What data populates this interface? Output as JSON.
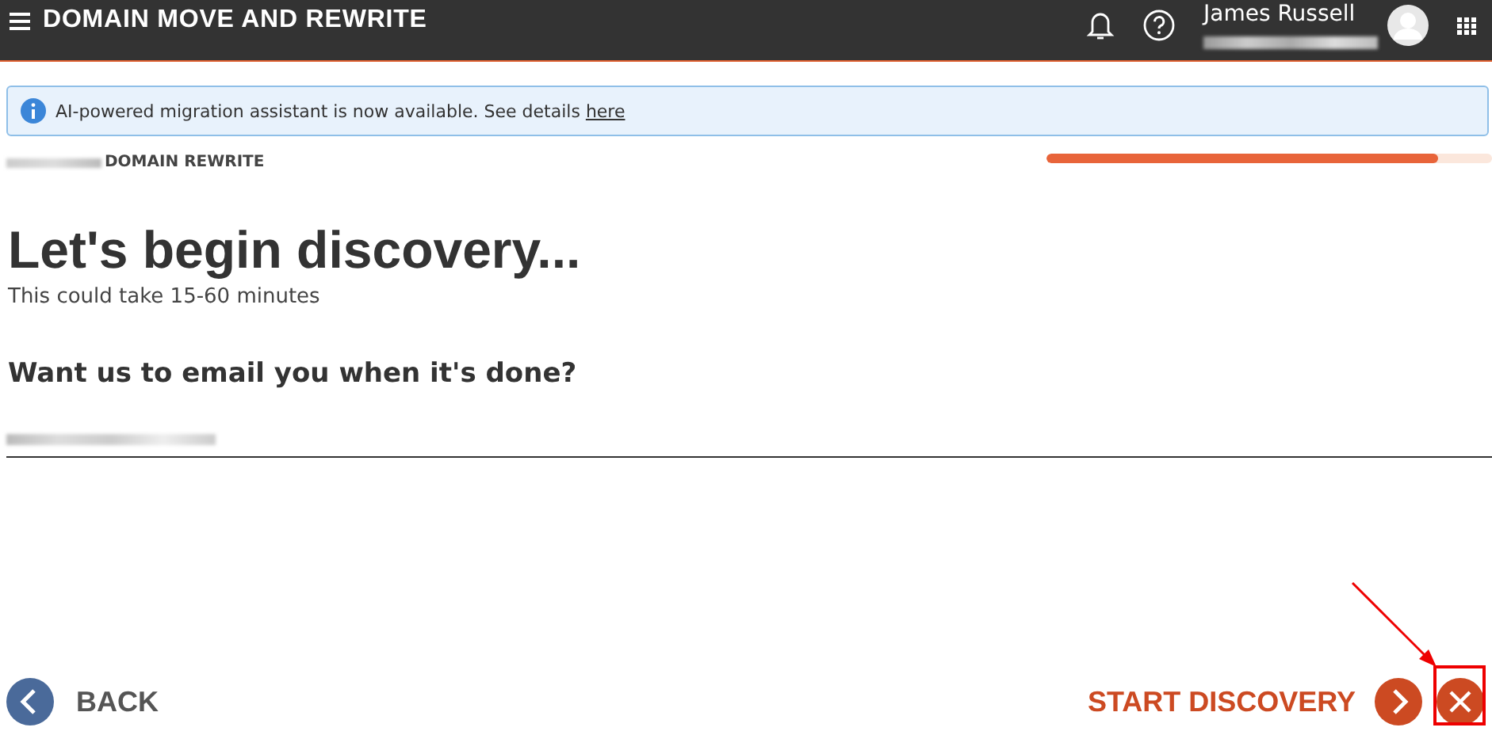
{
  "header": {
    "title": "DOMAIN MOVE AND REWRITE",
    "user_name": "James Russell"
  },
  "banner": {
    "text": "AI-powered migration assistant is now available. See details ",
    "link": "here"
  },
  "breadcrumb": {
    "current": "DOMAIN REWRITE"
  },
  "progress": {
    "level": 0.88
  },
  "heading": "Let's begin discovery...",
  "subtitle": "This could take 15-60 minutes",
  "question": "Want us to email you when it's done?",
  "footer": {
    "back": "BACK",
    "start": "START DISCOVERY"
  }
}
